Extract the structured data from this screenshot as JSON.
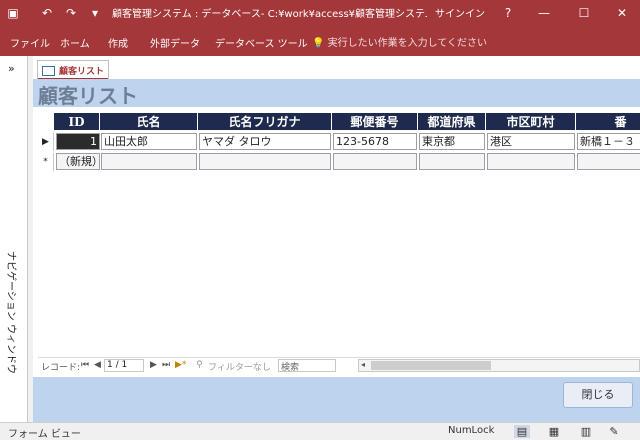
{
  "titlebar": {
    "app_icon": "save-icon",
    "undo": "↶",
    "redo": "↷",
    "qa_menu": "▾",
    "title": "顧客管理システム : データベース- C:¥work¥access¥顧客管理システム.…",
    "signin": "サインイン",
    "help": "?",
    "minimize": "—",
    "maximize": "☐",
    "close": "✕"
  },
  "ribbon": {
    "tabs": [
      "ファイル",
      "ホーム",
      "作成",
      "外部データ",
      "データベース ツール"
    ],
    "tellme": "実行したい作業を入力してください",
    "tellme_icon": "💡"
  },
  "navpane": {
    "toggle": "»",
    "label": "ナビゲーション ウィンドウ"
  },
  "document": {
    "tab_label": "顧客リスト",
    "form_title": "顧客リスト"
  },
  "grid": {
    "columns": [
      "ID",
      "氏名",
      "氏名フリガナ",
      "郵便番号",
      "都道府県",
      "市区町村",
      "番"
    ],
    "rows": [
      {
        "selector": "▶",
        "values": [
          "1",
          "山田太郎",
          "ヤマダ タロウ",
          "123-5678",
          "東京都",
          "港区",
          "新橋１－３"
        ]
      }
    ],
    "new_row": {
      "selector": "*",
      "label": "（新規）"
    }
  },
  "record_nav": {
    "label": "レコード:",
    "first": "⏮",
    "prev": "◀",
    "position": "1 / 1",
    "next": "▶",
    "last": "⏭",
    "new": "▶*",
    "filter": "フィルターなし",
    "search_placeholder": "検索"
  },
  "footer": {
    "close_label": "閉じる"
  },
  "statusbar": {
    "view": "フォーム ビュー",
    "numlock": "NumLock"
  }
}
